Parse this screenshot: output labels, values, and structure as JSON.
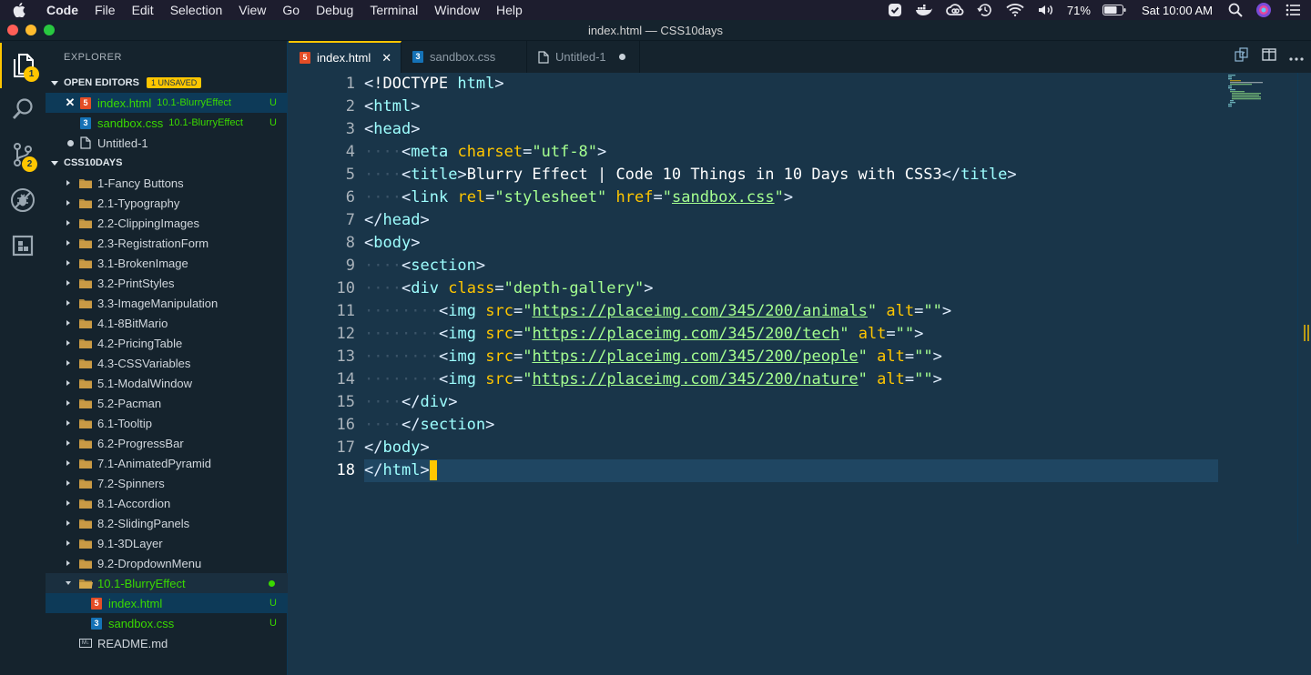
{
  "menubar": {
    "items": [
      "Code",
      "File",
      "Edit",
      "Selection",
      "View",
      "Go",
      "Debug",
      "Terminal",
      "Window",
      "Help"
    ],
    "battery": "71%",
    "clock": "Sat 10:00 AM"
  },
  "window": {
    "title": "index.html — CSS10days"
  },
  "activity": {
    "explorer_badge": "1",
    "scm_badge": "2"
  },
  "sidebar": {
    "title": "EXPLORER",
    "open_editors": {
      "header": "OPEN EDITORS",
      "unsaved": "1 UNSAVED",
      "items": [
        {
          "name": "index.html",
          "folder": "10.1-BlurryEffect",
          "status": "U"
        },
        {
          "name": "sandbox.css",
          "folder": "10.1-BlurryEffect",
          "status": "U"
        },
        {
          "name": "Untitled-1"
        }
      ]
    },
    "workspace": {
      "header": "CSS10DAYS",
      "folders": [
        "1-Fancy Buttons",
        "2.1-Typography",
        "2.2-ClippingImages",
        "2.3-RegistrationForm",
        "3.1-BrokenImage",
        "3.2-PrintStyles",
        "3.3-ImageManipulation",
        "4.1-8BitMario",
        "4.2-PricingTable",
        "4.3-CSSVariables",
        "5.1-ModalWindow",
        "5.2-Pacman",
        "6.1-Tooltip",
        "6.2-ProgressBar",
        "7.1-AnimatedPyramid",
        "7.2-Spinners",
        "8.1-Accordion",
        "8.2-SlidingPanels",
        "9.1-3DLayer",
        "9.2-DropdownMenu"
      ],
      "open_folder": "10.1-BlurryEffect",
      "open_children": [
        {
          "name": "index.html",
          "status": "U"
        },
        {
          "name": "sandbox.css",
          "status": "U"
        }
      ],
      "readme": "README.md"
    }
  },
  "tabs": [
    {
      "label": "index.html",
      "active": true
    },
    {
      "label": "sandbox.css"
    },
    {
      "label": "Untitled-1"
    }
  ],
  "editor": {
    "line_numbers": [
      "1",
      "2",
      "3",
      "4",
      "5",
      "6",
      "7",
      "8",
      "9",
      "10",
      "11",
      "12",
      "13",
      "14",
      "15",
      "16",
      "17",
      "18"
    ],
    "lines": [
      "<!DOCTYPE html>",
      "<html>",
      "<head>",
      "    <meta charset=\"utf-8\">",
      "    <title>Blurry Effect | Code 10 Things in 10 Days with CSS3</title>",
      "    <link rel=\"stylesheet\" href=\"sandbox.css\">",
      "</head>",
      "<body>",
      "    <section>",
      "    <div class=\"depth-gallery\">",
      "        <img src=\"https://placeimg.com/345/200/animals\" alt=\"\">",
      "        <img src=\"https://placeimg.com/345/200/tech\" alt=\"\">",
      "        <img src=\"https://placeimg.com/345/200/people\" alt=\"\">",
      "        <img src=\"https://placeimg.com/345/200/nature\" alt=\"\">",
      "    </div>",
      "    </section>",
      "</body>",
      "</html>"
    ]
  },
  "colors": {
    "accent": "#ffc600",
    "editor_bg": "#193549",
    "sidebar_bg": "#15232d",
    "git_untracked": "#3ad900"
  }
}
